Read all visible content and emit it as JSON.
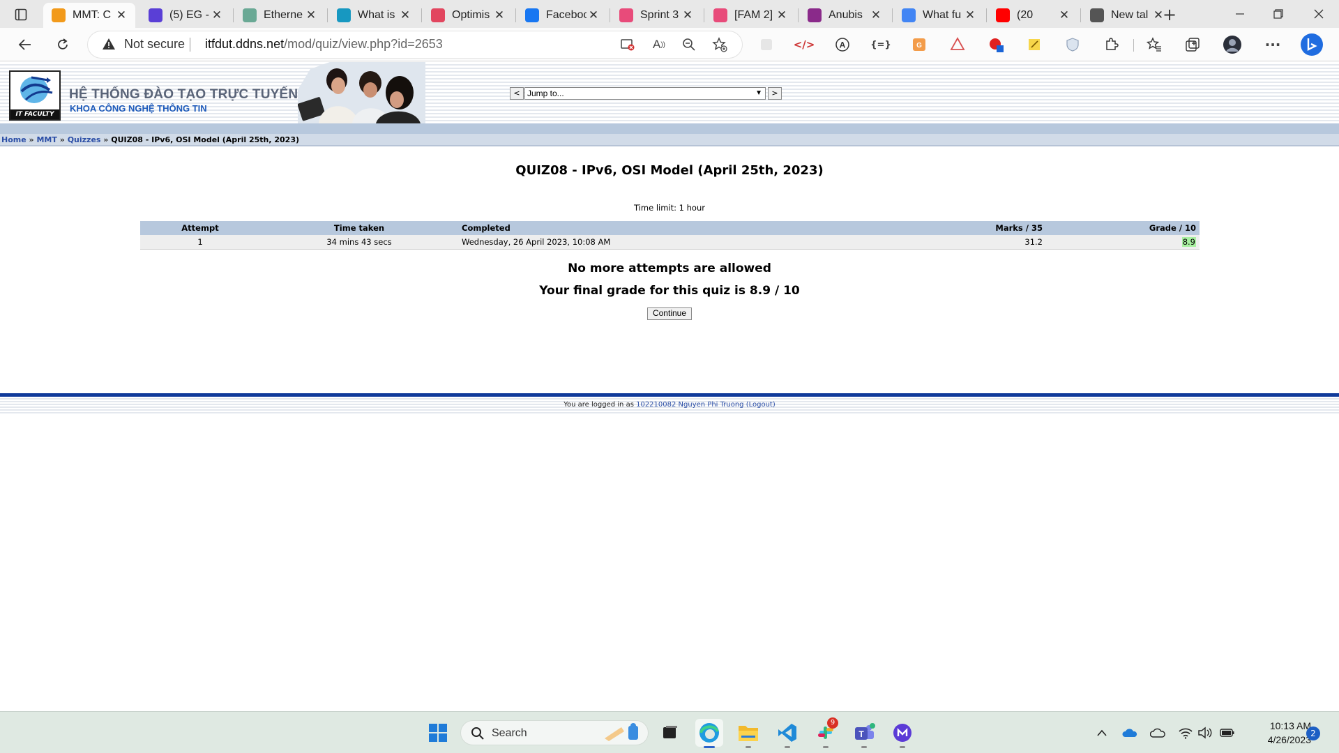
{
  "browser": {
    "tabs": [
      {
        "title": "MMT: C",
        "icon": "moodle-icon",
        "color": "#f29a1b",
        "active": true
      },
      {
        "title": "(5) EG -",
        "icon": "wordpress-icon",
        "color": "#5a3fd6"
      },
      {
        "title": "Etherne",
        "icon": "chatgpt-icon",
        "color": "#6aa995"
      },
      {
        "title": "What is",
        "icon": "salesforce-icon",
        "color": "#1798c1"
      },
      {
        "title": "Optimis",
        "icon": "toptal-icon",
        "color": "#e2465f"
      },
      {
        "title": "Faceboo",
        "icon": "facebook-icon",
        "color": "#1877f2"
      },
      {
        "title": "Sprint 3",
        "icon": "clickup-icon",
        "color": "#e84b7a"
      },
      {
        "title": "[FAM 2]",
        "icon": "clickup-icon",
        "color": "#e84b7a"
      },
      {
        "title": "Anubis",
        "icon": "anubis-icon",
        "color": "#8a2a8a"
      },
      {
        "title": "What fu",
        "icon": "google-icon",
        "color": "#4285f4"
      },
      {
        "title": "(20",
        "icon": "youtube-icon",
        "color": "#ff0000"
      },
      {
        "title": "New tal",
        "icon": "new-tab-icon",
        "color": "#555555"
      }
    ],
    "address": {
      "security_label": "Not secure",
      "url_host": "itfdut.ddns.net",
      "url_path": "/mod/quiz/view.php?id=2653"
    }
  },
  "site": {
    "title": "HỆ THỐNG ĐÀO TẠO TRỰC TUYẾN",
    "subtitle": "KHOA CÔNG NGHỆ THÔNG TIN",
    "logo_label": "IT FACULTY",
    "jump_prev": "<",
    "jump_next": ">",
    "jump_placeholder": "Jump to..."
  },
  "breadcrumb": {
    "home": "Home",
    "course": "MMT",
    "section": "Quizzes",
    "current": "QUIZ08 - IPv6, OSI Model (April 25th, 2023)",
    "sep": "»"
  },
  "quiz": {
    "title": "QUIZ08 - IPv6, OSI Model (April 25th, 2023)",
    "time_limit": "Time limit: 1 hour",
    "table": {
      "headers": [
        "Attempt",
        "Time taken",
        "Completed",
        "Marks / 35",
        "Grade / 10"
      ],
      "rows": [
        {
          "attempt": "1",
          "time_taken": "34 mins 43 secs",
          "completed": "Wednesday, 26 April 2023, 10:08 AM",
          "marks": "31.2",
          "grade": "8.9"
        }
      ]
    },
    "no_more_attempts": "No more attempts are allowed",
    "final_grade": "Your final grade for this quiz is 8.9 / 10",
    "continue_label": "Continue"
  },
  "footer": {
    "prefix": "You are logged in as",
    "user": "102210082 Nguyen Phi Truong",
    "open_paren": "(",
    "logout": "Logout",
    "close_paren": ")"
  },
  "taskbar": {
    "search_label": "Search",
    "slack_badge": "9",
    "time": "10:13 AM",
    "date": "4/26/2023",
    "notifications": "2"
  }
}
